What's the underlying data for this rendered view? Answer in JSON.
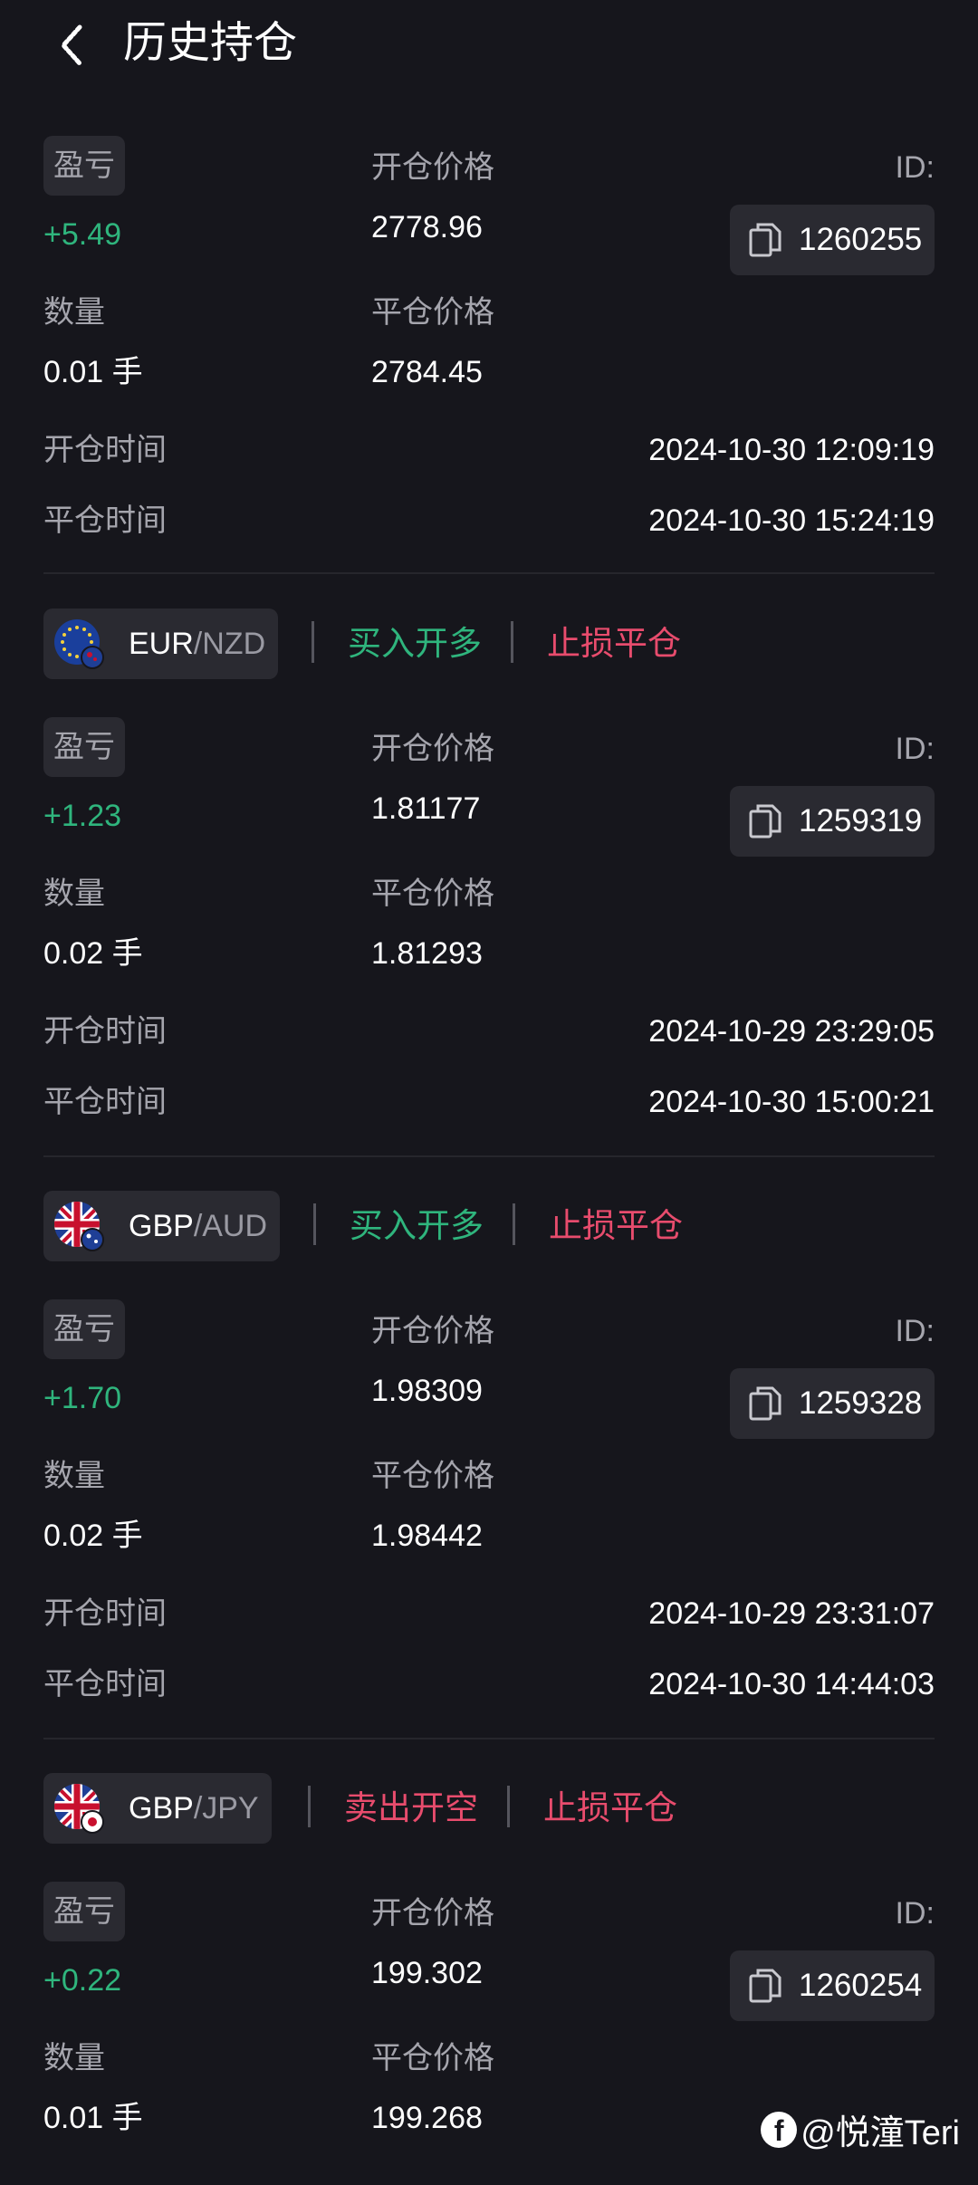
{
  "header": {
    "title": "历史持仓"
  },
  "labels": {
    "pl": "盈亏",
    "open_price": "开仓价格",
    "close_price": "平仓价格",
    "qty": "数量",
    "open_time": "开仓时间",
    "close_time": "平仓时间",
    "id": "ID:"
  },
  "positions": [
    {
      "pl": "+5.49",
      "open_price": "2778.96",
      "close_price": "2784.45",
      "qty": "0.01 手",
      "id": "1260255",
      "open_time": "2024-10-30 12:09:19",
      "close_time": "2024-10-30 15:24:19"
    },
    {
      "pair_base": "EUR",
      "pair_quote": "/NZD",
      "direction": "买入开多",
      "close_type": "止损平仓",
      "pl": "+1.23",
      "open_price": "1.81177",
      "close_price": "1.81293",
      "qty": "0.02 手",
      "id": "1259319",
      "open_time": "2024-10-29 23:29:05",
      "close_time": "2024-10-30 15:00:21"
    },
    {
      "pair_base": "GBP",
      "pair_quote": "/AUD",
      "direction": "买入开多",
      "close_type": "止损平仓",
      "pl": "+1.70",
      "open_price": "1.98309",
      "close_price": "1.98442",
      "qty": "0.02 手",
      "id": "1259328",
      "open_time": "2024-10-29 23:31:07",
      "close_time": "2024-10-30 14:44:03"
    },
    {
      "pair_base": "GBP",
      "pair_quote": "/JPY",
      "direction": "卖出开空",
      "close_type": "止损平仓",
      "pl": "+0.22",
      "open_price": "199.302",
      "close_price": "199.268",
      "qty": "0.01 手",
      "id": "1260254"
    }
  ],
  "watermark": {
    "text": "@悦潼Teri",
    "icon": "facebook-icon"
  },
  "colors": {
    "profit": "#2fb57d",
    "loss": "#e84c6d",
    "background": "#16161c",
    "chip": "#2a2a31"
  }
}
